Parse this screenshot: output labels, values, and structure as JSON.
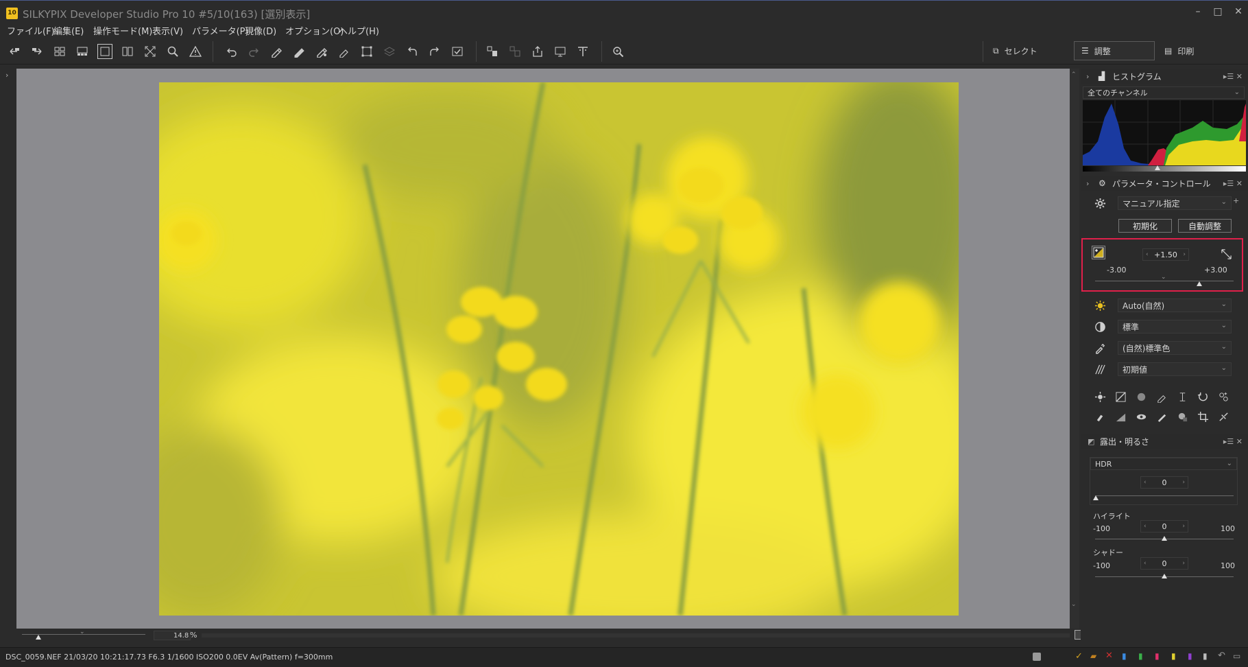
{
  "window": {
    "title": "SILKYPIX Developer Studio Pro 10   #5/10(163) [選別表示]",
    "logo": "10"
  },
  "menu": [
    "ファイル(F)",
    "編集(E)",
    "操作モード(M)",
    "表示(V)",
    "パラメータ(P)",
    "現像(D)",
    "オプション(O)",
    "ヘルプ(H)"
  ],
  "modes": {
    "select": "セレクト",
    "adjust": "調整",
    "print": "印刷"
  },
  "histogram": {
    "title": "ヒストグラム",
    "channel": "全てのチャンネル"
  },
  "param_control": {
    "title": "パラメータ・コントロール",
    "preset": "マニュアル指定",
    "reset_button": "初期化",
    "auto_button": "自動調整",
    "exposure_value": "+1.50",
    "exposure_min": "-3.00",
    "exposure_max": "+3.00",
    "exposure_level": 0.75,
    "white_balance": "Auto(自然)",
    "tone": "標準",
    "color": "(自然)標準色",
    "sharpness": "初期値"
  },
  "exposure_panel": {
    "title": "露出・明るさ",
    "hdr_label": "HDR",
    "hdr_value": "0",
    "highlight_label": "ハイライト",
    "highlight_value": "0",
    "highlight_min": "-100",
    "highlight_max": "100",
    "shadow_label": "シャドー",
    "shadow_value": "0",
    "shadow_min": "-100",
    "shadow_max": "100"
  },
  "zoom": {
    "value": "14.8",
    "unit": "%"
  },
  "status": {
    "text": "DSC_0059.NEF 21/03/20 10:21:17.73 F6.3 1/1600 ISO200  0.0EV Av(Pattern) f=300mm"
  },
  "colors": {
    "accent_red": "#e0204a",
    "photo_yellow": "#e8dd3a"
  }
}
